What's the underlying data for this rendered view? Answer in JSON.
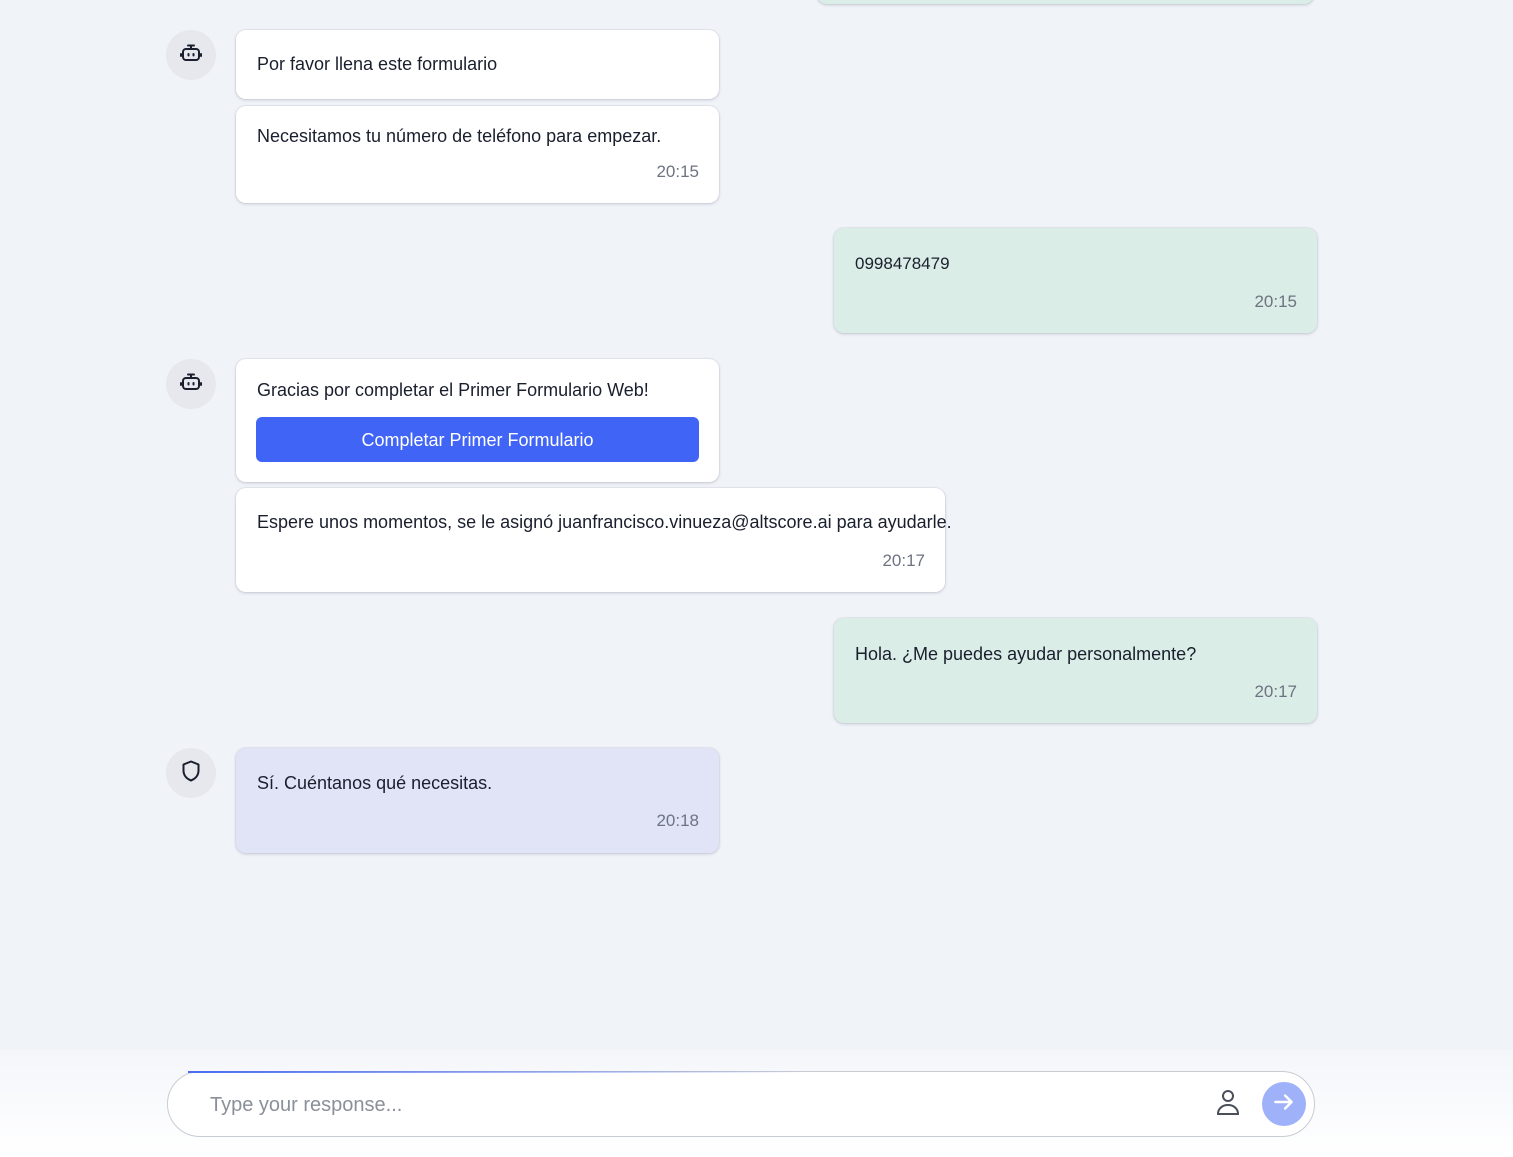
{
  "messages": [
    {
      "text": "Por favor llena este formulario"
    },
    {
      "text": "Necesitamos tu número de teléfono para empezar.",
      "time": "20:15"
    },
    {
      "text": "0998478479",
      "time": "20:15"
    },
    {
      "text": "Gracias por completar el Primer Formulario Web!",
      "button": "Completar Primer Formulario"
    },
    {
      "text": "Espere unos momentos, se le asignó juanfrancisco.vinueza@altscore.ai para ayudarle.",
      "time": "20:17"
    },
    {
      "text": "Hola. ¿Me puedes ayudar personalmente?",
      "time": "20:17"
    },
    {
      "text": "Sí. Cuéntanos qué necesitas.",
      "time": "20:18"
    }
  ],
  "avatars": {
    "bot": "robot-icon",
    "agent": "shield-icon"
  },
  "composer": {
    "placeholder": "Type your response...",
    "send_icon": "arrow-right-icon",
    "user_icon": "user-icon"
  },
  "colors": {
    "background": "#f0f3f8",
    "bot_bubble": "#ffffff",
    "user_bubble": "#dbede7",
    "agent_bubble": "#e0e4f6",
    "button": "#4064f5",
    "send_button": "#9fb1f8"
  }
}
